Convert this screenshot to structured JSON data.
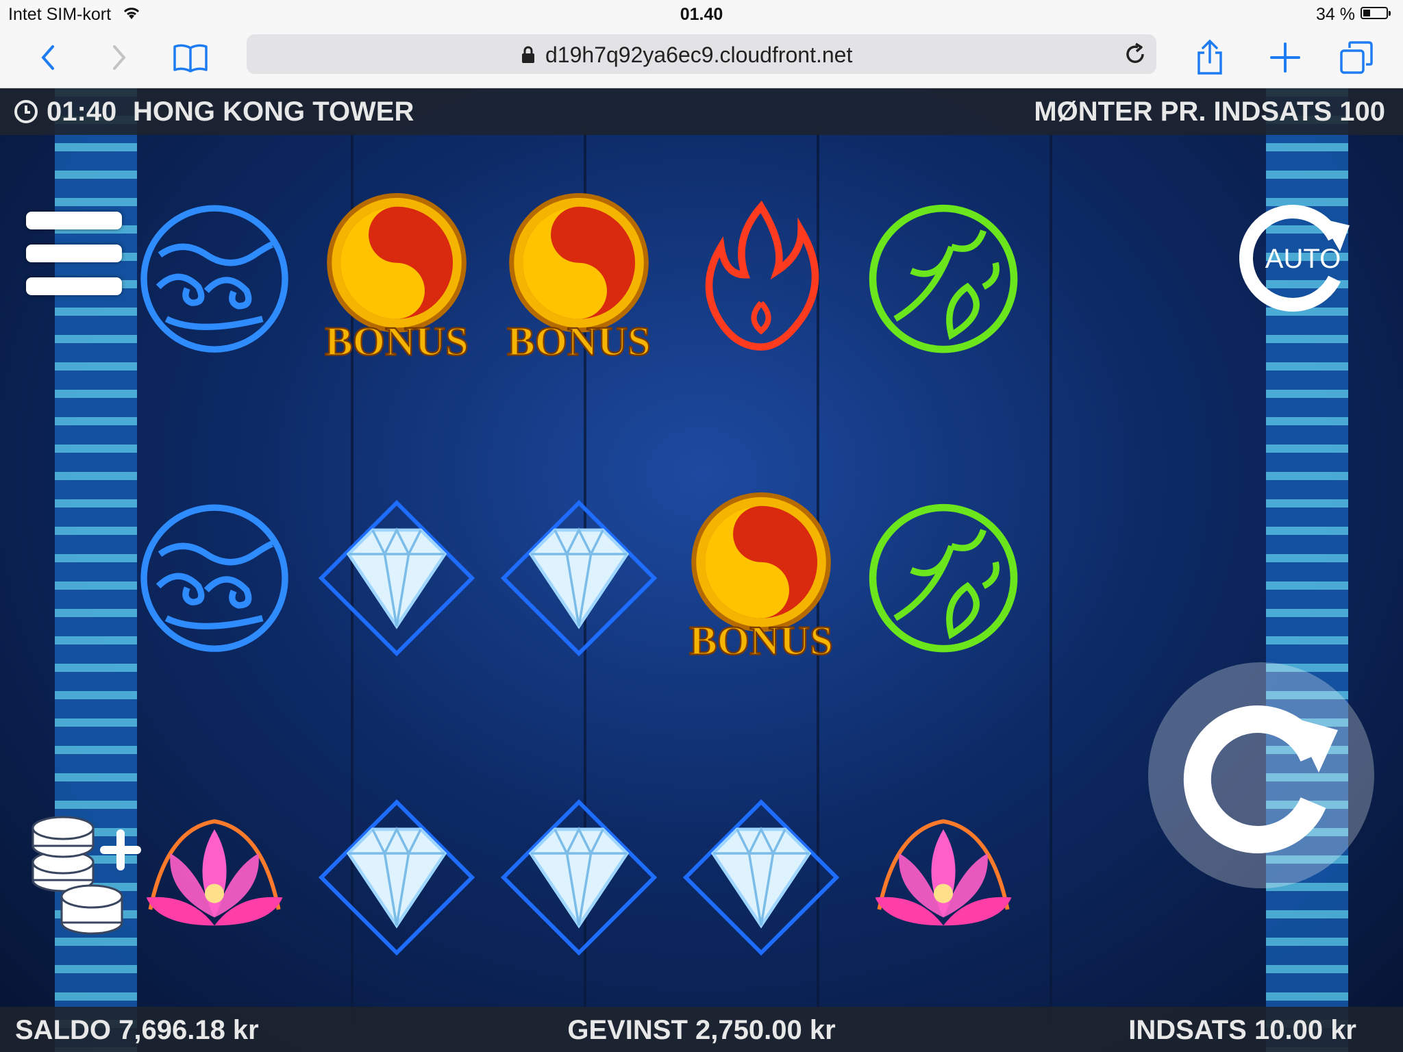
{
  "statusbar": {
    "carrier": "Intet SIM-kort",
    "time": "01.40",
    "battery": "34 %"
  },
  "browser": {
    "url": "d19h7q92ya6ec9.cloudfront.net"
  },
  "game": {
    "time": "01:40",
    "title": "HONG KONG TOWER",
    "coins_per_bet": "MØNTER PR. INDSATS 100",
    "auto_label": "AUTO",
    "bonus_label": "BONUS",
    "reels": [
      [
        "water",
        "water",
        "lotus"
      ],
      [
        "bonus",
        "diamond",
        "diamond"
      ],
      [
        "bonus",
        "diamond",
        "diamond"
      ],
      [
        "fire",
        "bonus",
        "diamond"
      ],
      [
        "leaf",
        "leaf",
        "lotus"
      ]
    ],
    "balance": "SALDO 7,696.18 kr",
    "win": "GEVINST 2,750.00 kr",
    "bet": "INDSATS 10.00 kr"
  },
  "colors": {
    "bonus_gold": "#f4b400",
    "water_blue": "#2f8cff",
    "fire_red": "#ff3b1f",
    "leaf_green": "#6be61c",
    "lotus_pink": "#ff5fc8"
  }
}
